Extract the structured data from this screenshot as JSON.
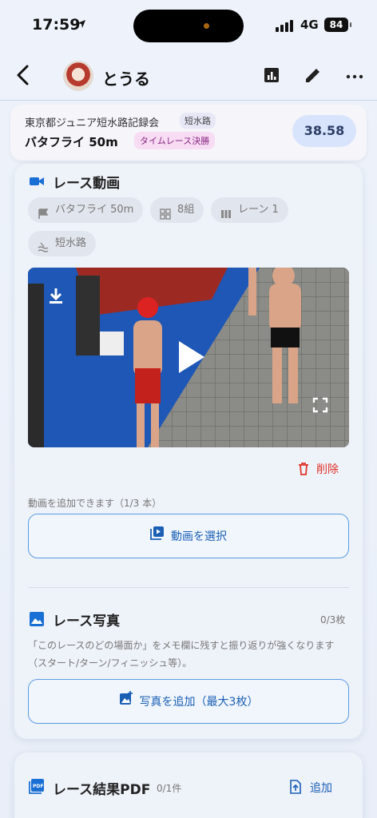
{
  "status": {
    "time": "17:59",
    "network": "4G",
    "battery": "84"
  },
  "header": {
    "back_icon": "chevron-left-icon",
    "username": "とうる"
  },
  "summary": {
    "meet_name": "東京都ジュニア短水路記録会",
    "course_tag": "短水路",
    "event": "バタフライ 50m",
    "round_tag": "タイムレース決勝",
    "time": "38.58"
  },
  "video_section": {
    "title": "レース動画",
    "chips": {
      "stroke": "バタフライ 50m",
      "heat": "8組",
      "lane": "レーン 1",
      "course": "短水路"
    },
    "delete_label": "削除",
    "hint": "動画を追加できます（1/3 本）",
    "select_button": "動画を選択"
  },
  "photo_section": {
    "title": "レース写真",
    "count": "0/3枚",
    "description": "「このレースのどの場面か」をメモ欄に残すと振り返りが強くなります（スタート/ターン/フィニッシュ等）。",
    "add_button": "写真を追加（最大3枚）"
  },
  "pdf_section": {
    "title": "レース結果PDF",
    "count": "0/1件",
    "add_label": "追加"
  },
  "colors": {
    "accent": "#1a5fb4",
    "danger": "#e0342b",
    "time_pill": "#d7e4fb"
  }
}
